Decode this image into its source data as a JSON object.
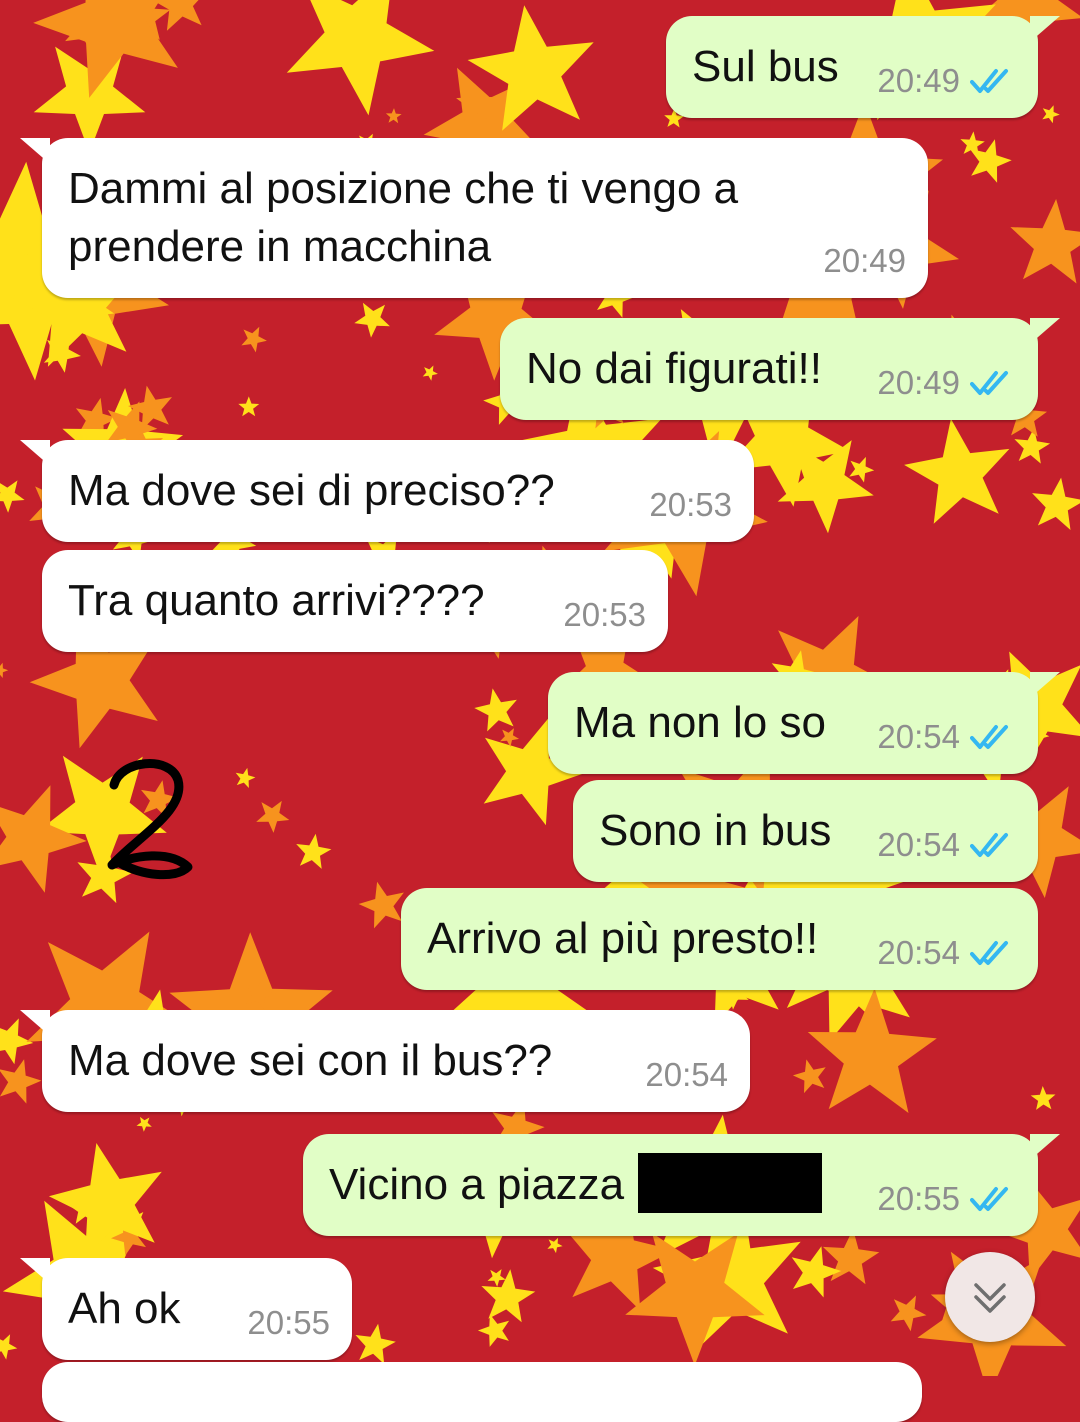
{
  "annotation": {
    "handwritten_mark": "2"
  },
  "messages": [
    {
      "direction": "out",
      "text": "Sul bus",
      "time": "20:49",
      "status": "read"
    },
    {
      "direction": "in",
      "text": "Dammi al posizione che ti vengo a",
      "text2": "prendere in macchina",
      "time": "20:49"
    },
    {
      "direction": "out",
      "text": "No dai figurati!!",
      "time": "20:49",
      "status": "read"
    },
    {
      "direction": "in",
      "text": "Ma dove sei di preciso??",
      "time": "20:53"
    },
    {
      "direction": "in",
      "text": "Tra quanto arrivi????",
      "time": "20:53"
    },
    {
      "direction": "out",
      "text": "Ma non lo so",
      "time": "20:54",
      "status": "read"
    },
    {
      "direction": "out",
      "text": "Sono in bus",
      "time": "20:54",
      "status": "read"
    },
    {
      "direction": "out",
      "text": "Arrivo al più presto!!",
      "time": "20:54",
      "status": "read"
    },
    {
      "direction": "in",
      "text": "Ma dove sei con il bus??",
      "time": "20:54"
    },
    {
      "direction": "out",
      "text": "Vicino a piazza",
      "time": "20:55",
      "status": "read"
    },
    {
      "direction": "in",
      "text": "Ah ok",
      "time": "20:55"
    }
  ],
  "icons": {
    "read_receipt": "double-check-icon",
    "scroll_down": "chevron-double-down-icon"
  },
  "colors": {
    "background": "#c4202b",
    "star_yellow": "#ffe11a",
    "star_orange": "#f7931e",
    "incoming_bubble": "#ffffff",
    "outgoing_bubble": "#e1fec6",
    "tick_blue": "#34b7f1",
    "timestamp": "#8e8e8e"
  }
}
